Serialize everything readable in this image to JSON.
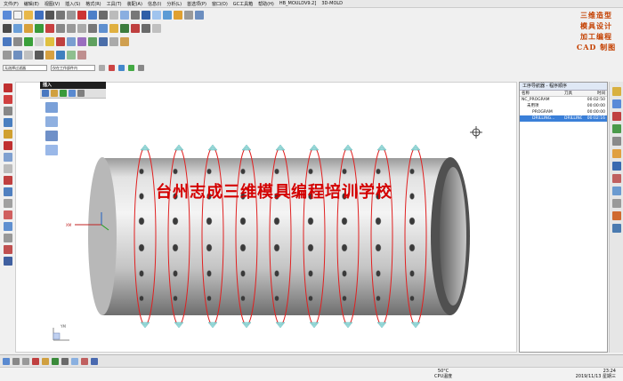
{
  "menubar": {
    "items": [
      "文件(F)",
      "编辑(E)",
      "视图(V)",
      "插入(S)",
      "格式(R)",
      "工具(T)",
      "装配(A)",
      "信息(I)",
      "分析(L)",
      "首选项(P)",
      "窗口(O)",
      "GC工具箱",
      "帮助(H)",
      "HB_MOULDV9.2]",
      "3D-MOLD"
    ]
  },
  "brand": {
    "lines": [
      "三维造型",
      "模具设计",
      "加工编程",
      "CAD 制图"
    ]
  },
  "selection_bar": {
    "filter_value": "无选择过滤器",
    "scope_value": "仅在工作部件内"
  },
  "insert_panel": {
    "title": "插入"
  },
  "viewport": {
    "watermark": "台州志成三维模具编程培训学校",
    "axis_label": "XM",
    "tag_label": "YM"
  },
  "navigator": {
    "title": "工序导航器 - 程序顺序",
    "columns": [
      "名称",
      "刀具",
      "时间"
    ],
    "rows": [
      {
        "name": "NC_PROGRAM",
        "tool": "",
        "time": "00:02:50"
      },
      {
        "name": "未用项",
        "tool": "",
        "time": "00:00:00"
      },
      {
        "name": "PROGRAM",
        "tool": "",
        "time": "00:00:00"
      },
      {
        "name": "DRILLING...",
        "tool": "DRILLING...",
        "time": "00:02:16"
      }
    ]
  },
  "taskbar": {
    "temperature": "50°C",
    "temperature_label": "CPU温度",
    "time": "23:24",
    "date": "2019/11/13 星期三"
  },
  "colors": {
    "watermark": "#d40000",
    "toolpath": "#e02020",
    "selection_row": "#3a7fd8",
    "brand_text": "#c44000"
  },
  "chart_data": null
}
